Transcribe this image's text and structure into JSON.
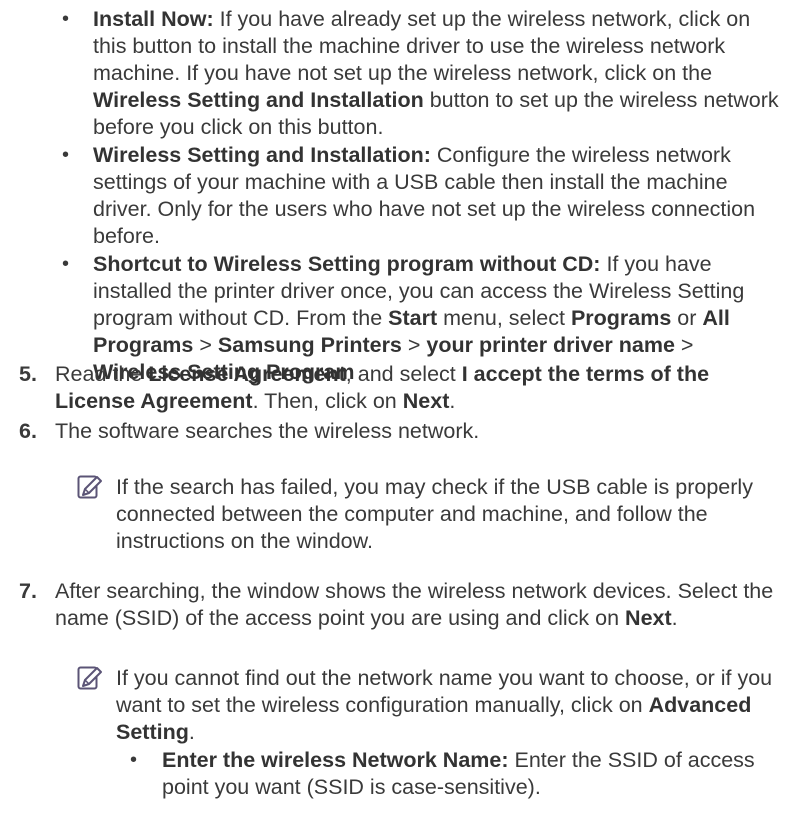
{
  "bullets": [
    {
      "bold": "Install Now:",
      "segments": [
        {
          "t": " If you have already set up the wireless network, click on this button to install the machine driver to use the wireless network machine. If you have not set up the wireless network, click on the "
        },
        {
          "b": "Wireless Setting and Installation"
        },
        {
          "t": " button to set up the wireless network before you click on this button."
        }
      ]
    },
    {
      "bold": "Wireless Setting and Installation:",
      "segments": [
        {
          "t": " Configure the wireless network settings of your machine with a USB cable then install the machine driver. Only for the users who have not set up the wireless connection before."
        }
      ]
    },
    {
      "bold": "Shortcut to Wireless Setting program without CD:",
      "segments": [
        {
          "t": " If you have installed the printer driver once, you can access the Wireless Setting program without CD. From the "
        },
        {
          "b": "Start"
        },
        {
          "t": " menu, select "
        },
        {
          "b": "Programs"
        },
        {
          "t": " or "
        },
        {
          "b": "All Programs"
        },
        {
          "t": " > "
        },
        {
          "b": "Samsung Printers"
        },
        {
          "t": " > "
        },
        {
          "b": "your printer driver name"
        },
        {
          "t": " > "
        },
        {
          "b": "Wireless Setting Program"
        }
      ]
    }
  ],
  "steps": [
    {
      "num": "5.",
      "segments": [
        {
          "t": "Read the "
        },
        {
          "b": "License Agreement"
        },
        {
          "t": ", and select "
        },
        {
          "b": "I accept the terms of the License Agreement"
        },
        {
          "t": ". Then, click on "
        },
        {
          "b": "Next"
        },
        {
          "t": "."
        }
      ]
    },
    {
      "num": "6.",
      "segments": [
        {
          "t": "The software searches the wireless network."
        }
      ]
    },
    {
      "num": "7.",
      "segments": [
        {
          "t": "After searching, the window shows the wireless network devices. Select the name (SSID) of the access point you are using and click on "
        },
        {
          "b": "Next"
        },
        {
          "t": "."
        }
      ]
    }
  ],
  "notes": [
    {
      "icon": "note-icon",
      "segments": [
        {
          "t": "If the search has failed, you may check if the USB cable is properly connected between the computer and machine, and follow the instructions on the window."
        }
      ]
    },
    {
      "icon": "note-icon",
      "segments": [
        {
          "t": "If you cannot find out the network name you want to choose, or if you want to set the wireless configuration manually, click on "
        },
        {
          "b": "Advanced Setting"
        },
        {
          "t": "."
        }
      ]
    }
  ],
  "sub_bullet": {
    "bold": "Enter the wireless Network Name:",
    "segments": [
      {
        "t": " Enter the SSID of access point you want (SSID is case-sensitive)."
      }
    ]
  },
  "colors": {
    "text": "#3a3a3a",
    "icon": "#5b5476"
  }
}
